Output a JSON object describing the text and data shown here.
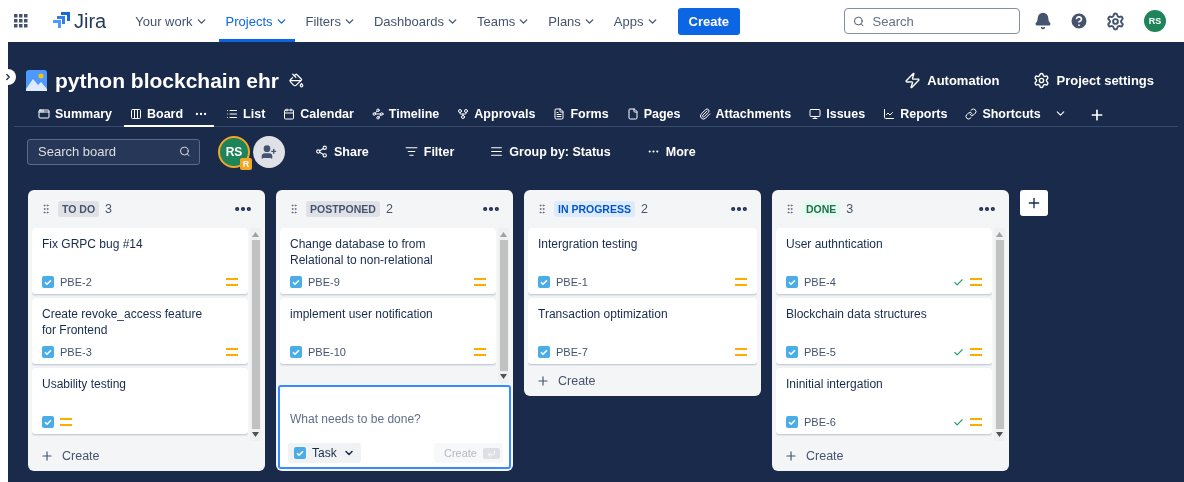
{
  "nav": {
    "product": "Jira",
    "items": [
      {
        "label": "Your work",
        "selected": false
      },
      {
        "label": "Projects",
        "selected": true
      },
      {
        "label": "Filters",
        "selected": false
      },
      {
        "label": "Dashboards",
        "selected": false
      },
      {
        "label": "Teams",
        "selected": false
      },
      {
        "label": "Plans",
        "selected": false
      },
      {
        "label": "Apps",
        "selected": false
      }
    ],
    "create": "Create",
    "search": {
      "placeholder": "Search"
    },
    "avatar": "RS"
  },
  "project": {
    "title": "python blockchain ehr",
    "actions": [
      "Automation",
      "Project settings"
    ],
    "tabs": [
      {
        "label": "Summary",
        "selected": false
      },
      {
        "label": "Board",
        "selected": true
      },
      {
        "label": "List",
        "selected": false
      },
      {
        "label": "Calendar",
        "selected": false
      },
      {
        "label": "Timeline",
        "selected": false
      },
      {
        "label": "Approvals",
        "selected": false
      },
      {
        "label": "Forms",
        "selected": false
      },
      {
        "label": "Pages",
        "selected": false
      },
      {
        "label": "Attachments",
        "selected": false
      },
      {
        "label": "Issues",
        "selected": false
      },
      {
        "label": "Reports",
        "selected": false
      },
      {
        "label": "Shortcuts",
        "selected": false
      }
    ]
  },
  "toolbar": {
    "search": {
      "placeholder": "Search board"
    },
    "avatar": "RS",
    "avatar_badge": "R",
    "actions": [
      "Share",
      "Filter",
      "Group by: Status",
      "More"
    ]
  },
  "columns": [
    {
      "name": "TO DO",
      "count": "3",
      "color": "#dfe1e6",
      "scrollable": true,
      "cards": [
        {
          "title": "Fix GRPC bug #14",
          "key": "PBE-2",
          "done": false
        },
        {
          "title": "Create revoke_access feature for Frontend",
          "key": "PBE-3",
          "done": false
        },
        {
          "title": "Usability testing",
          "done": false
        }
      ],
      "create": "Create"
    },
    {
      "name": "POSTPONED",
      "count": "2",
      "color": "#dfe1e6",
      "scrollable": true,
      "cards": [
        {
          "title": "Change database to from Relational to non-relational",
          "key": "PBE-9",
          "done": false
        },
        {
          "title": "implement user notification",
          "key": "PBE-10",
          "done": false
        }
      ],
      "create_form": {
        "placeholder": "What needs to be done?",
        "type": "Task",
        "button": "Create"
      }
    },
    {
      "name": "IN PROGRESS",
      "count": "2",
      "color": "#deebff",
      "scrollable": false,
      "cards": [
        {
          "title": "Intergration testing",
          "key": "PBE-1",
          "done": false
        },
        {
          "title": "Transaction optimization",
          "key": "PBE-7",
          "done": false
        }
      ],
      "create": "Create"
    },
    {
      "name": "DONE",
      "count": "3",
      "color": "#e3fcef",
      "scrollable": true,
      "cards": [
        {
          "title": "User authntication",
          "key": "PBE-4",
          "done": true
        },
        {
          "title": "Blockchain data structures",
          "key": "PBE-5",
          "done": true
        },
        {
          "title": "Ininitial intergation",
          "key": "PBE-6",
          "done": true
        }
      ],
      "create": "Create"
    }
  ]
}
